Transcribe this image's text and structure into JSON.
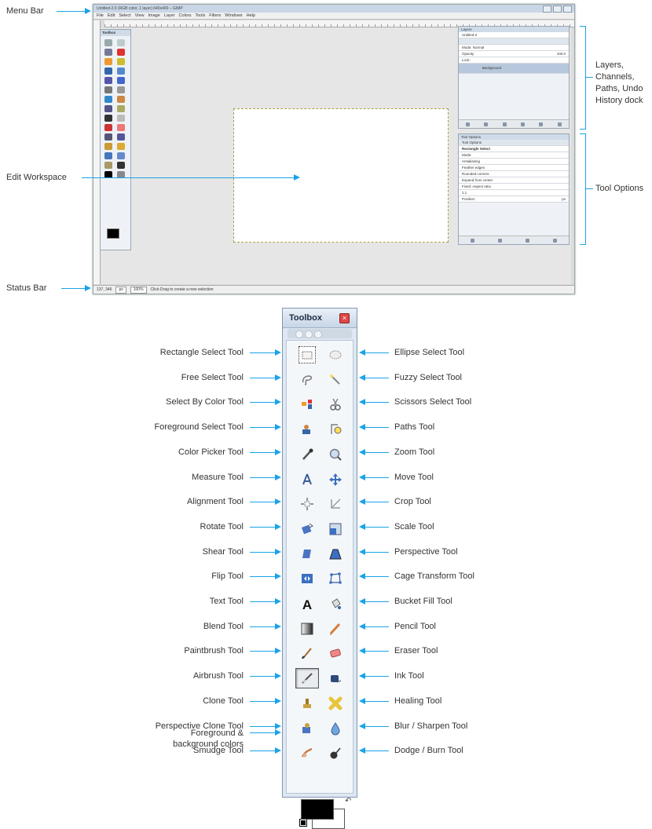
{
  "gimp": {
    "title": "Untitled-2.0 (RGB color, 1 layer) 640x400 – GIMP",
    "menu": [
      "File",
      "Edit",
      "Select",
      "View",
      "Image",
      "Layer",
      "Colors",
      "Tools",
      "Filters",
      "Windows",
      "Help"
    ],
    "status": {
      "coords": "137, 346",
      "unit": "px",
      "zoom": "100%",
      "message": "Click-Drag to create a new selection"
    },
    "layers": {
      "title": "Layers",
      "image": "Untitled-2",
      "mode": "Mode: Normal",
      "opacity": "Opacity",
      "opacity_val": "100.0",
      "lock": "Lock:",
      "layer_name": "Background"
    },
    "tool_options": {
      "title": "Tool Options",
      "tab": "Tool Options",
      "heading": "Rectangle Select",
      "mode": "Mode:",
      "antialias": "Antialiasing",
      "feather": "Feather edges",
      "rounded": "Rounded corners",
      "expand": "Expand from center",
      "fixed": "Fixed:",
      "aspect": "Aspect ratio",
      "value": "1:1",
      "position": "Position:",
      "px": "px"
    }
  },
  "callouts": {
    "menu_bar": "Menu Bar",
    "edit_workspace": "Edit Workspace",
    "status_bar": "Status Bar",
    "layers_dock": [
      "Layers,",
      "Channels,",
      "Paths, Undo",
      "History dock"
    ],
    "tool_options": "Tool Options"
  },
  "toolbox": {
    "title": "Toolbox",
    "close": "×",
    "swap": "↶",
    "colors_label": [
      "Foreground &",
      "background colors"
    ],
    "left_tools": [
      "Rectangle Select Tool",
      "Free Select Tool",
      "Select By Color Tool",
      "Foreground Select Tool",
      "Color Picker Tool",
      "Measure Tool",
      "Alignment Tool",
      "Rotate Tool",
      "Shear Tool",
      "Flip Tool",
      "Text Tool",
      "Blend Tool",
      "Paintbrush Tool",
      "Airbrush Tool",
      "Clone Tool",
      "Perspective Clone Tool",
      "Smudge Tool"
    ],
    "right_tools": [
      "Ellipse Select Tool",
      "Fuzzy Select Tool",
      "Scissors Select Tool",
      "Paths Tool",
      "Zoom Tool",
      "Move Tool",
      "Crop Tool",
      "Scale Tool",
      "Perspective Tool",
      "Cage Transform Tool",
      "Bucket Fill Tool",
      "Pencil Tool",
      "Eraser Tool",
      "Ink Tool",
      "Healing Tool",
      "Blur / Sharpen Tool",
      "Dodge / Burn Tool"
    ],
    "left_icons": [
      "rectangle-select-icon",
      "free-select-icon",
      "select-by-color-icon",
      "foreground-select-icon",
      "color-picker-icon",
      "measure-icon",
      "alignment-icon",
      "rotate-icon",
      "shear-icon",
      "flip-icon",
      "text-icon",
      "blend-icon",
      "paintbrush-icon",
      "airbrush-icon",
      "clone-icon",
      "perspective-clone-icon",
      "smudge-icon"
    ],
    "right_icons": [
      "ellipse-select-icon",
      "fuzzy-select-icon",
      "scissors-select-icon",
      "paths-icon",
      "zoom-icon",
      "move-icon",
      "crop-icon",
      "scale-icon",
      "perspective-icon",
      "cage-transform-icon",
      "bucket-fill-icon",
      "pencil-icon",
      "eraser-icon",
      "ink-icon",
      "healing-icon",
      "blur-sharpen-icon",
      "dodge-burn-icon"
    ]
  },
  "colors": {
    "accent": "#1aa3e8",
    "foreground": "#000000",
    "background": "#ffffff"
  }
}
